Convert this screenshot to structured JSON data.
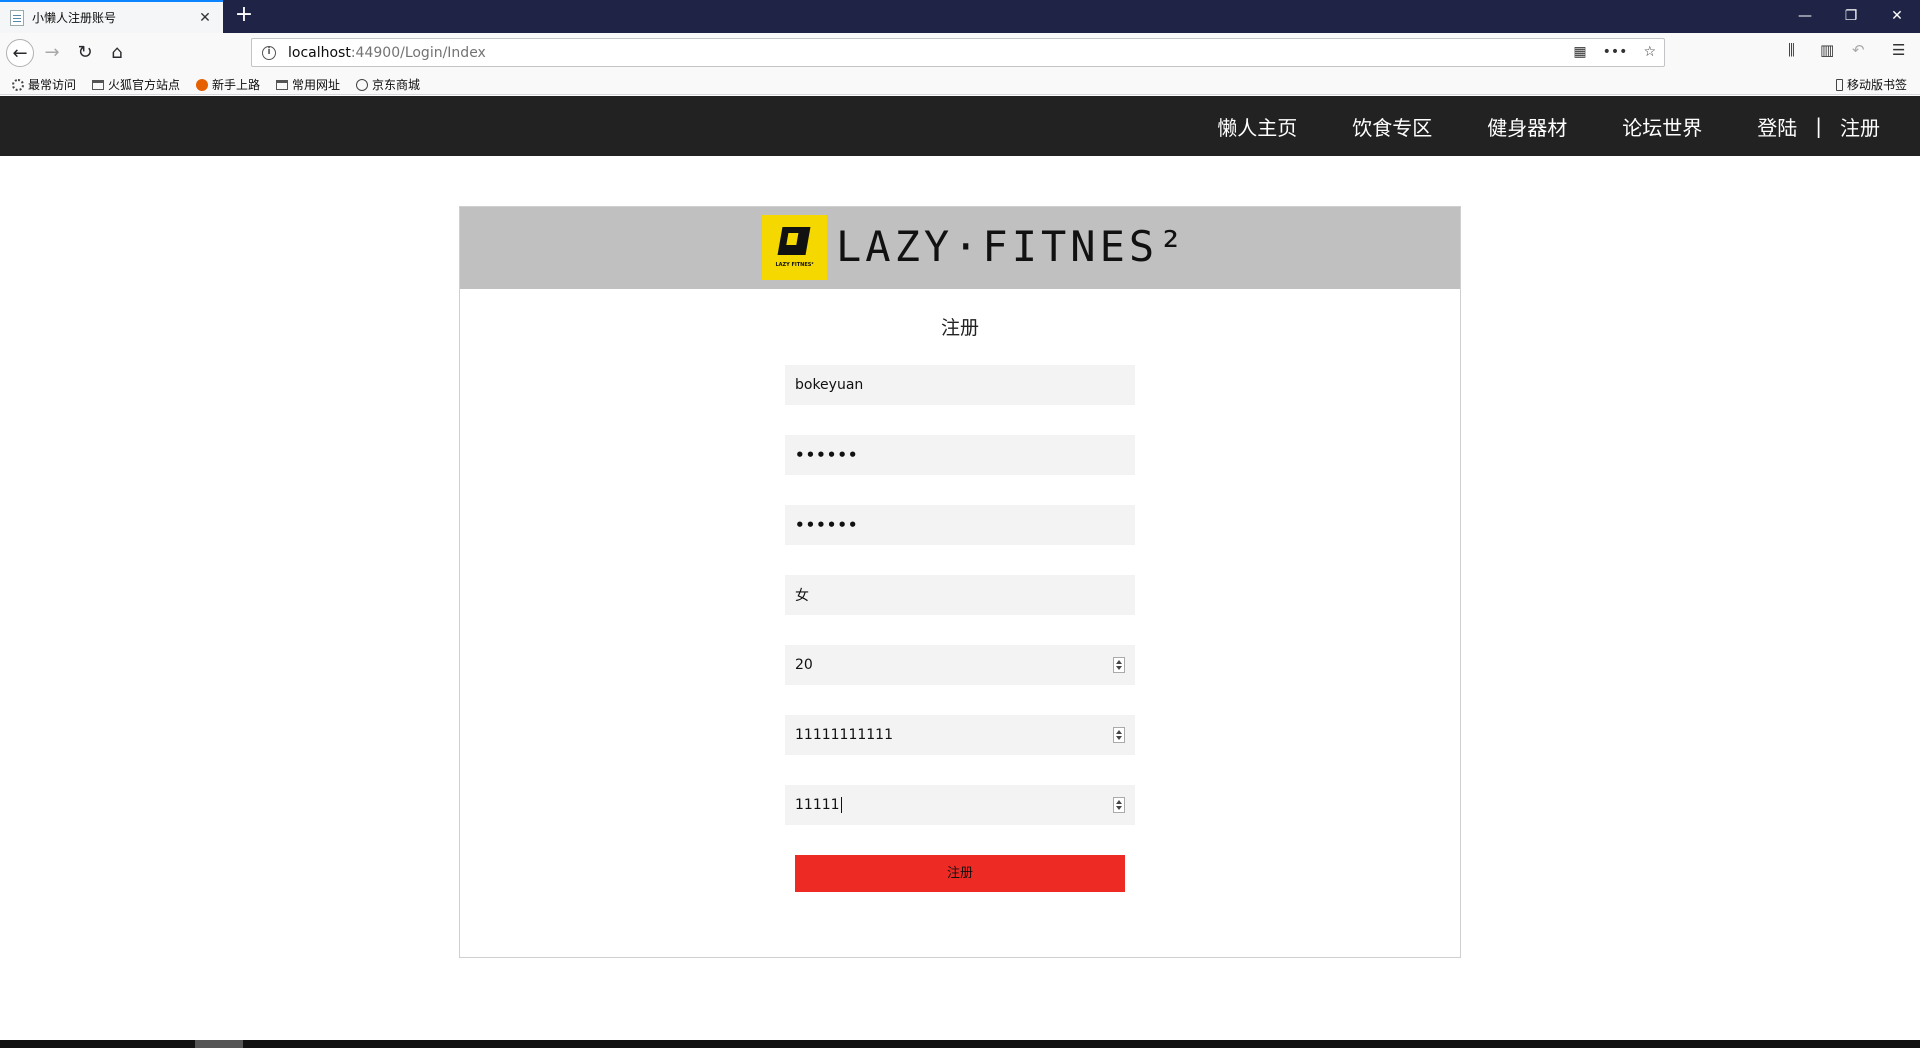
{
  "browser": {
    "tab_title": "小懒人注册账号",
    "url_host": "localhost",
    "url_rest": ":44900/Login/Index",
    "bookmarks": [
      "最常访问",
      "火狐官方站点",
      "新手上路",
      "常用网址",
      "京东商城"
    ],
    "mobile_bookmarks": "移动版书签"
  },
  "header": {
    "nav": [
      "懒人主页",
      "饮食专区",
      "健身器材",
      "论坛世界"
    ],
    "login": "登陆",
    "separator": "|",
    "register": "注册"
  },
  "panel": {
    "logo_small_text": "LAZY FITNES²",
    "logo_text": "LAZY·FITNES²",
    "title": "注册",
    "fields": {
      "username": "bokeyuan",
      "password": "••••••",
      "confirm_password": "••••••",
      "gender": "女",
      "age": "20",
      "phone": "11111111111",
      "code": "11111"
    },
    "submit_label": "注册"
  },
  "icons": {
    "tab_close": "close-icon",
    "new_tab": "plus-icon",
    "back": "back-arrow-icon",
    "forward": "forward-arrow-icon",
    "reload": "reload-icon",
    "home": "home-icon"
  },
  "colors": {
    "header_bg": "#222222",
    "panel_head_bg": "#c0c0c0",
    "logo_yellow": "#f5d800",
    "submit_red": "#ee2a24"
  }
}
